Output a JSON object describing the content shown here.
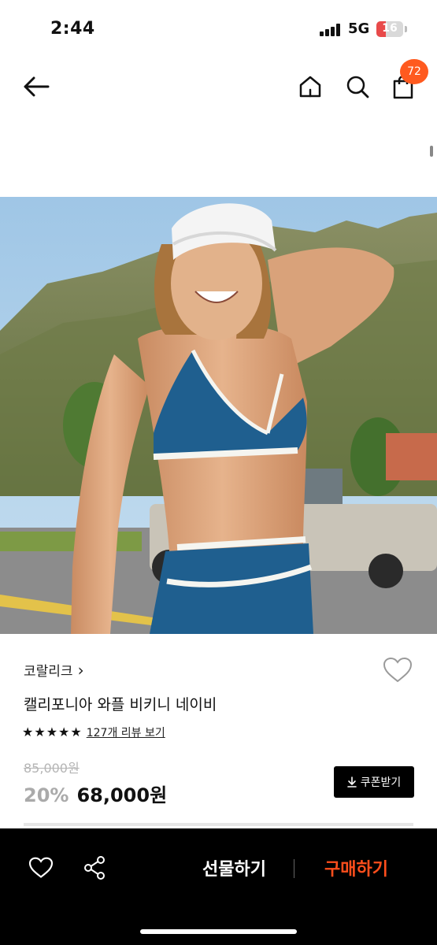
{
  "status_bar": {
    "time": "2:44",
    "network": "5G",
    "battery": "16"
  },
  "nav": {
    "back_icon": "arrow-left-icon",
    "home_icon": "home-icon",
    "search_icon": "search-icon",
    "cart_icon": "shopping-bag-icon",
    "cart_badge": "72",
    "badge_color": "#ff5a1f"
  },
  "product": {
    "brand": "코랄리크",
    "brand_chevron": "›",
    "name": "캘리포니아 와플 비키니 네이비",
    "rating_stars": 5,
    "review_link": "127개 리뷰 보기",
    "original_price": "85,000원",
    "discount": "20%",
    "price": "68,000원",
    "coupon_label": "쿠폰받기",
    "coupon_icon": "download-icon",
    "wish_icon": "heart-outline-icon"
  },
  "bottom_bar": {
    "wish_icon": "heart-outline-icon",
    "share_icon": "share-icon",
    "gift_label": "선물하기",
    "buy_label": "구매하기",
    "buy_color": "#ff4e1c"
  }
}
